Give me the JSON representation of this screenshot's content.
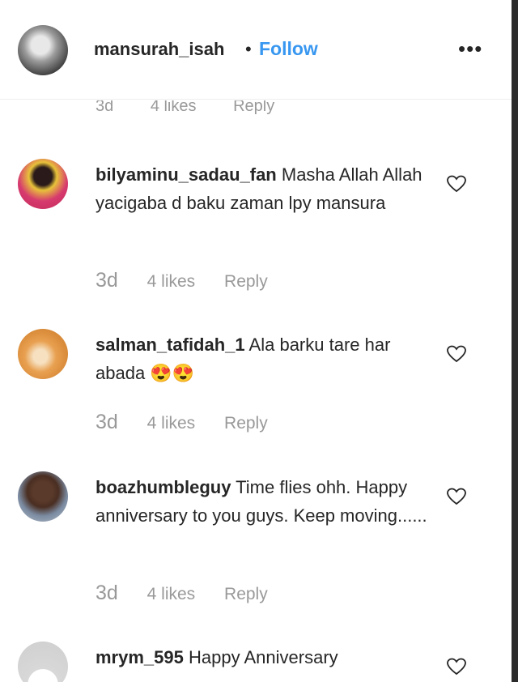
{
  "header": {
    "username": "mansurah_isah",
    "separator": "•",
    "follow_label": "Follow",
    "more_label": "•••"
  },
  "prev_comment_meta": {
    "time": "3d",
    "likes": "4 likes",
    "reply": "Reply"
  },
  "comments": [
    {
      "username": "bilyaminu_sadau_fan",
      "text": "Masha Allah Allah yacigaba d baku zaman lpy mansura",
      "time": "3d",
      "likes": "4 likes",
      "reply": "Reply"
    },
    {
      "username": "salman_tafidah_1",
      "text": "Ala barku tare har abada 😍😍",
      "time": "3d",
      "likes": "4 likes",
      "reply": "Reply"
    },
    {
      "username": "boazhumbleguy",
      "text": "Time flies ohh. Happy anniversary to you guys. Keep moving......",
      "time": "3d",
      "likes": "4 likes",
      "reply": "Reply"
    },
    {
      "username": "mrym_595",
      "text": "Happy Anniversary"
    }
  ],
  "colors": {
    "link": "#3897f0",
    "muted": "#999999",
    "text": "#262626"
  }
}
